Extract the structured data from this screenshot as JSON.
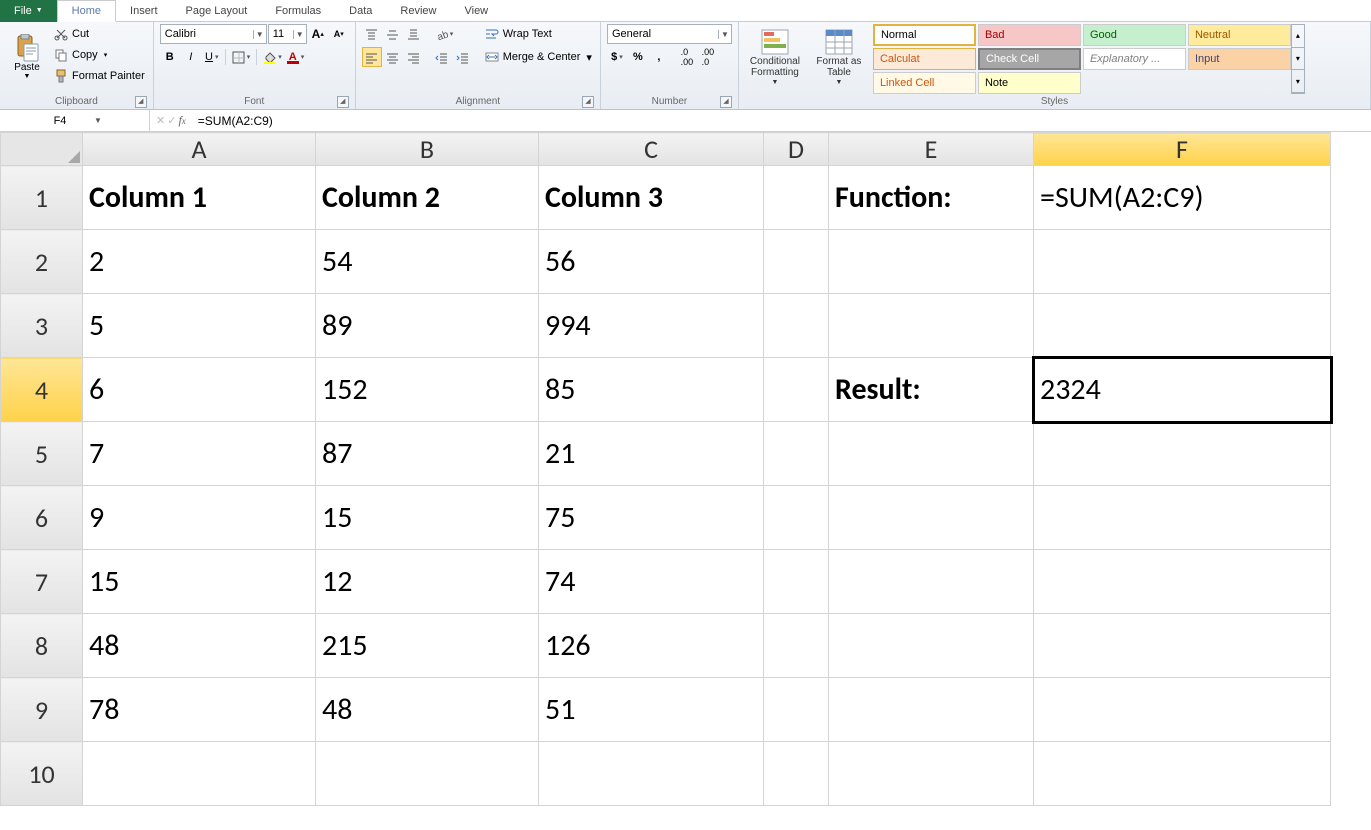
{
  "tabs": {
    "file": "File",
    "home": "Home",
    "insert": "Insert",
    "page_layout": "Page Layout",
    "formulas": "Formulas",
    "data": "Data",
    "review": "Review",
    "view": "View"
  },
  "clipboard": {
    "paste": "Paste",
    "cut": "Cut",
    "copy": "Copy",
    "format_painter": "Format Painter",
    "group": "Clipboard"
  },
  "font": {
    "name": "Calibri",
    "size": "11",
    "group": "Font"
  },
  "alignment": {
    "wrap": "Wrap Text",
    "merge": "Merge & Center",
    "group": "Alignment"
  },
  "number": {
    "format": "General",
    "group": "Number"
  },
  "styles": {
    "conditional": "Conditional Formatting",
    "format_table": "Format as Table",
    "group": "Styles",
    "items": [
      "Normal",
      "Bad",
      "Good",
      "Neutral",
      "Calculat",
      "Check Cell",
      "Explanatory ...",
      "Input",
      "Linked Cell",
      "Note"
    ]
  },
  "namebox": "F4",
  "formula": "=SUM(A2:C9)",
  "columns": [
    "A",
    "B",
    "C",
    "D",
    "E",
    "F"
  ],
  "rows": [
    "1",
    "2",
    "3",
    "4",
    "5",
    "6",
    "7",
    "8",
    "9",
    "10"
  ],
  "cells": {
    "A1": "Column 1",
    "B1": "Column 2",
    "C1": "Column 3",
    "E1": "Function:",
    "F1": "=SUM(A2:C9)",
    "A2": "2",
    "B2": "54",
    "C2": "56",
    "A3": "5",
    "B3": "89",
    "C3": "994",
    "A4": "6",
    "B4": "152",
    "C4": "85",
    "E4": "Result:",
    "F4": "2324",
    "A5": "7",
    "B5": "87",
    "C5": "21",
    "A6": "9",
    "B6": "15",
    "C6": "75",
    "A7": "15",
    "B7": "12",
    "C7": "74",
    "A8": "48",
    "B8": "215",
    "C8": "126",
    "A9": "78",
    "B9": "48",
    "C9": "51"
  },
  "selected_cell": "F4"
}
